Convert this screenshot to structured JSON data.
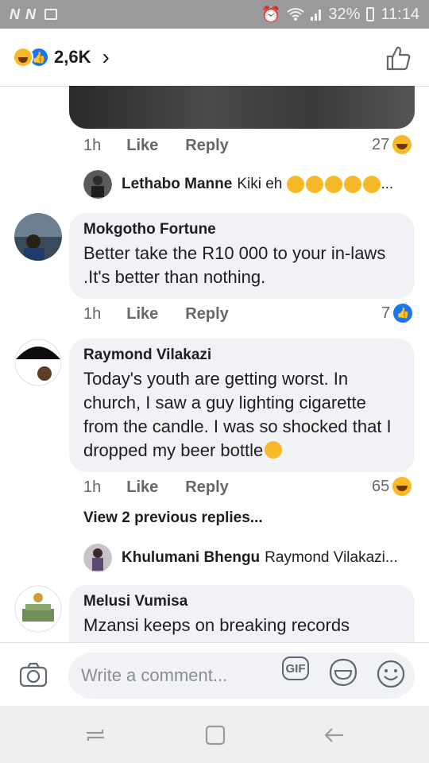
{
  "status_bar": {
    "left_icons": "N N",
    "signal_text": "32%",
    "time": "11:14"
  },
  "header": {
    "reaction_count": "2,6K",
    "chevron": "›"
  },
  "comments": [
    {
      "time": "1h",
      "like_label": "Like",
      "reply_label": "Reply",
      "reaction_count": "27"
    },
    {
      "author": "Mokgotho Fortune",
      "text": "Better take the R10 000 to your in-laws .It's better than nothing.",
      "time": "1h",
      "like_label": "Like",
      "reply_label": "Reply",
      "reaction_count": "7"
    },
    {
      "author": "Raymond Vilakazi",
      "text": "Today's youth are getting worst. In church, I saw a guy lighting cigarette from the candle. I was so shocked that I dropped my beer bottle",
      "time": "1h",
      "like_label": "Like",
      "reply_label": "Reply",
      "reaction_count": "65"
    },
    {
      "author": "Melusi Vumisa",
      "text": "Mzansi keeps on breaking records"
    }
  ],
  "replies": [
    {
      "author": "Lethabo Manne",
      "text": "Kiki eh",
      "ellipsis": "..."
    },
    {
      "author": "Khulumani Bhengu",
      "text": "Raymond Vilakazi..."
    }
  ],
  "view_previous": "View 2 previous replies...",
  "composer": {
    "placeholder": "Write a comment...",
    "gif_label": "GIF"
  },
  "colors": {
    "accent": "#1877f2",
    "haha": "#f7b928",
    "bubble": "#f0f2f5",
    "status_bar": "#9a9a9a"
  }
}
